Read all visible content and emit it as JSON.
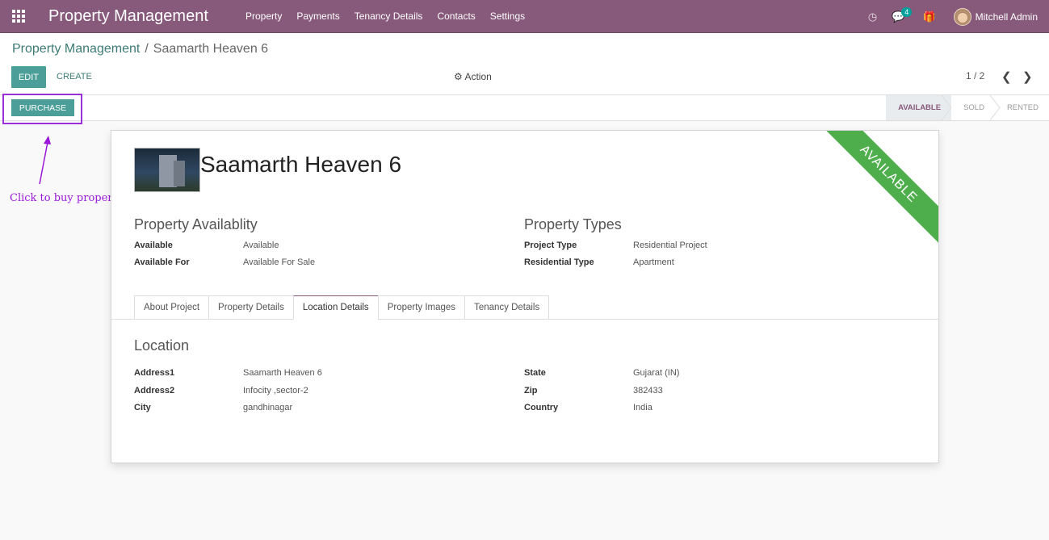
{
  "navbar": {
    "brand": "Property Management",
    "menu": [
      "Property",
      "Payments",
      "Tenancy Details",
      "Contacts",
      "Settings"
    ],
    "message_count": "4",
    "user_name": "Mitchell Admin"
  },
  "control": {
    "breadcrumb_parent": "Property Management",
    "breadcrumb_current": "Saamarth Heaven 6",
    "edit_label": "EDIT",
    "create_label": "CREATE",
    "action_label": "Action",
    "pager": "1 / 2"
  },
  "statusbar": {
    "purchase_label": "PURCHASE",
    "stages": [
      "AVAILABLE",
      "SOLD",
      "RENTED"
    ],
    "active_stage": "AVAILABLE"
  },
  "annotation": "Click to buy property",
  "record": {
    "title": "Saamarth Heaven 6",
    "ribbon": "AVAILABLE",
    "availability": {
      "heading": "Property Availablity",
      "available_label": "Available",
      "available_value": "Available",
      "available_for_label": "Available For",
      "available_for_value": "Available For Sale"
    },
    "types": {
      "heading": "Property Types",
      "project_type_label": "Project Type",
      "project_type_value": "Residential Project",
      "residential_type_label": "Residential Type",
      "residential_type_value": "Apartment"
    },
    "tabs": [
      "About Project",
      "Property Details",
      "Location Details",
      "Property Images",
      "Tenancy Details"
    ],
    "active_tab": "Location Details",
    "location": {
      "heading": "Location",
      "address1_label": "Address1",
      "address1_value": "Saamarth Heaven 6",
      "address2_label": "Address2",
      "address2_value": "Infocity ,sector-2",
      "city_label": "City",
      "city_value": "gandhinagar",
      "state_label": "State",
      "state_value": "Gujarat (IN)",
      "zip_label": "Zip",
      "zip_value": "382433",
      "country_label": "Country",
      "country_value": "India"
    }
  },
  "colors": {
    "navbar": "#875a7b",
    "primary": "#4c9e98",
    "ribbon": "#4fae4c",
    "annotation": "#9b18d9"
  }
}
